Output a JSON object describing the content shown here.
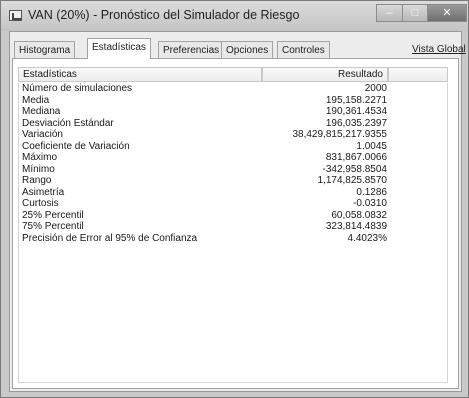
{
  "window": {
    "title": "VAN (20%) - Pronóstico del Simulador de Riesgo"
  },
  "icons": {
    "app": "chart-app-icon",
    "minimize": "minimize-icon",
    "maximize": "maximize-icon",
    "close": "close-icon"
  },
  "tabs": [
    {
      "label": "Histograma",
      "active": false
    },
    {
      "label": "Estadísticas",
      "active": true
    },
    {
      "label": "Preferencias",
      "active": false
    },
    {
      "label": "Opciones",
      "active": false
    },
    {
      "label": "Controles",
      "active": false
    }
  ],
  "global_view_link": "Vista Global",
  "table": {
    "header_name": "Estadísticas",
    "header_value": "Resultado",
    "rows": [
      {
        "label": "Número de simulaciones",
        "value": "2000"
      },
      {
        "label": "Media",
        "value": "195,158.2271"
      },
      {
        "label": "Mediana",
        "value": "190,361.4534"
      },
      {
        "label": "Desviación Estándar",
        "value": "196,035.2397"
      },
      {
        "label": "Variación",
        "value": "38,429,815,217.9355"
      },
      {
        "label": "Coeficiente de Variación",
        "value": "1.0045"
      },
      {
        "label": "Máximo",
        "value": "831,867.0066"
      },
      {
        "label": "Mínimo",
        "value": "-342,958.8504"
      },
      {
        "label": "Rango",
        "value": "1,174,825.8570"
      },
      {
        "label": "Asimetría",
        "value": "0.1286"
      },
      {
        "label": "Curtosis",
        "value": "-0.0310"
      },
      {
        "label": "25% Percentil",
        "value": "60,058.0832"
      },
      {
        "label": "75% Percentil",
        "value": "323,814.4839"
      },
      {
        "label": "Precisión de Error al 95% de Confianza",
        "value": "4.4023%"
      }
    ]
  }
}
